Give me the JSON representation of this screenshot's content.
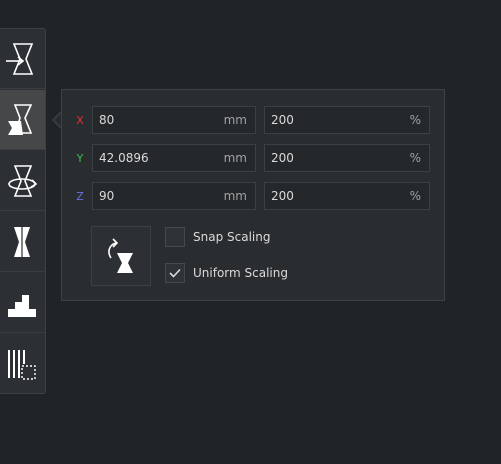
{
  "toolbar": {
    "tools": [
      {
        "name": "move",
        "icon": "move-icon",
        "active": false
      },
      {
        "name": "scale",
        "icon": "scale-icon",
        "active": true
      },
      {
        "name": "rotate",
        "icon": "rotate-icon",
        "active": false
      },
      {
        "name": "mirror",
        "icon": "mirror-icon",
        "active": false
      },
      {
        "name": "support",
        "icon": "support-blocker-icon",
        "active": false
      },
      {
        "name": "per-model-settings",
        "icon": "per-model-settings-icon",
        "active": false
      }
    ]
  },
  "scale_panel": {
    "axes": [
      {
        "label": "X",
        "color": "#e0303a",
        "mm": "80",
        "mm_unit": "mm",
        "percent": "200",
        "percent_unit": "%"
      },
      {
        "label": "Y",
        "color": "#3cc14a",
        "mm": "42.0896",
        "mm_unit": "mm",
        "percent": "200",
        "percent_unit": "%"
      },
      {
        "label": "Z",
        "color": "#6a6fe6",
        "mm": "90",
        "mm_unit": "mm",
        "percent": "200",
        "percent_unit": "%"
      }
    ],
    "reset_icon": "reset-scale-icon",
    "snap_scaling": {
      "label": "Snap Scaling",
      "checked": false
    },
    "uniform_scaling": {
      "label": "Uniform Scaling",
      "checked": true
    }
  }
}
